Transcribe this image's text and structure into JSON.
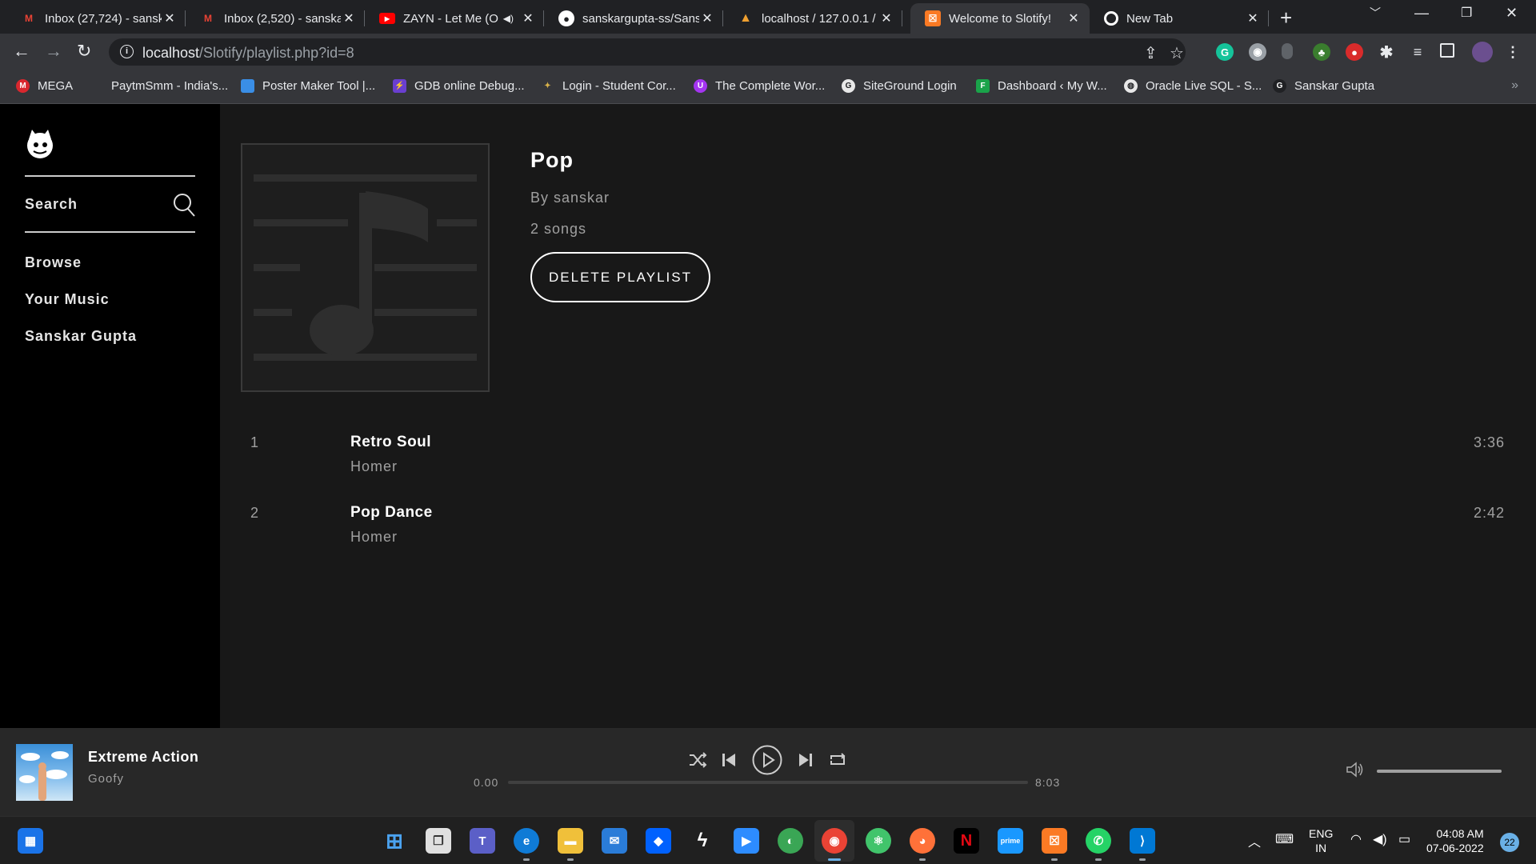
{
  "browser": {
    "tabs": [
      {
        "title": "Inbox (27,724) - sansk",
        "icon": "gmail-icon",
        "color": "#ea4335",
        "glyph": "M"
      },
      {
        "title": "Inbox (2,520) - sanska",
        "icon": "gmail-icon",
        "color": "#ea4335",
        "glyph": "M"
      },
      {
        "title": "ZAYN - Let Me (O",
        "icon": "youtube-icon",
        "color": "#ff0000",
        "glyph": "▶",
        "audio": true
      },
      {
        "title": "sanskargupta-ss/Sans",
        "icon": "github-icon",
        "color": "#ffffff",
        "glyph": "●"
      },
      {
        "title": "localhost / 127.0.0.1 /",
        "icon": "phpmyadmin-icon",
        "color": "#f0a030",
        "glyph": "▲"
      },
      {
        "title": "Welcome to Slotify!",
        "icon": "xampp-icon",
        "color": "#fb7a24",
        "glyph": "☒",
        "active": true
      },
      {
        "title": "New Tab",
        "icon": "chrome-icon",
        "color": "#ffffff",
        "glyph": "◉"
      }
    ],
    "url_host": "localhost",
    "url_path": "/Slotify/playlist.php?id=8",
    "bookmarks": [
      {
        "label": "MEGA",
        "icon": "mega-icon",
        "color": "#d9272e",
        "glyph": "M"
      },
      {
        "label": "PaytmSmm - India's...",
        "icon": "",
        "color": "",
        "glyph": ""
      },
      {
        "label": "Poster Maker Tool |...",
        "icon": "poster-maker-icon",
        "color": "#3a8ee6",
        "glyph": "▤"
      },
      {
        "label": "GDB online Debug...",
        "icon": "gdb-icon",
        "color": "#6a3fd0",
        "glyph": "⚡"
      },
      {
        "label": "Login - Student Cor...",
        "icon": "student-corner-icon",
        "color": "#b08a2e",
        "glyph": "✦"
      },
      {
        "label": "The Complete Wor...",
        "icon": "udemy-icon",
        "color": "#a435f0",
        "glyph": "U"
      },
      {
        "label": "SiteGround Login",
        "icon": "siteground-icon",
        "color": "#e8e8e8",
        "glyph": "G"
      },
      {
        "label": "Dashboard ‹ My W...",
        "icon": "dashboard-icon",
        "color": "#1aa34a",
        "glyph": "F"
      },
      {
        "label": "Oracle Live SQL - S...",
        "icon": "oracle-icon",
        "color": "#e8e8e8",
        "glyph": "◍"
      },
      {
        "label": "Sanskar Gupta",
        "icon": "google-icon",
        "color": "#202124",
        "glyph": "G"
      }
    ]
  },
  "sidebar": {
    "search_label": "Search",
    "nav": [
      {
        "label": "Browse",
        "name": "nav-browse"
      },
      {
        "label": "Your Music",
        "name": "nav-your-music"
      },
      {
        "label": "Sanskar Gupta",
        "name": "nav-profile"
      }
    ]
  },
  "playlist": {
    "title": "Pop",
    "owner": "By sanskar",
    "song_count": "2 songs",
    "delete_label": "DELETE PLAYLIST",
    "tracks": [
      {
        "num": "1",
        "name": "Retro Soul",
        "artist": "Homer",
        "duration": "3:36"
      },
      {
        "num": "2",
        "name": "Pop Dance",
        "artist": "Homer",
        "duration": "2:42"
      }
    ]
  },
  "now_playing": {
    "title": "Extreme Action",
    "artist": "Goofy",
    "time_current": "0.00",
    "time_total": "8:03",
    "progress": 0.0,
    "volume": 1.0
  },
  "taskbar": {
    "lang_line1": "ENG",
    "lang_line2": "IN",
    "time": "04:08 AM",
    "date": "07-06-2022",
    "notifications": "22"
  },
  "colors": {
    "main_bg": "#181818",
    "sidebar_bg": "#000000",
    "player_bg": "#282828"
  }
}
